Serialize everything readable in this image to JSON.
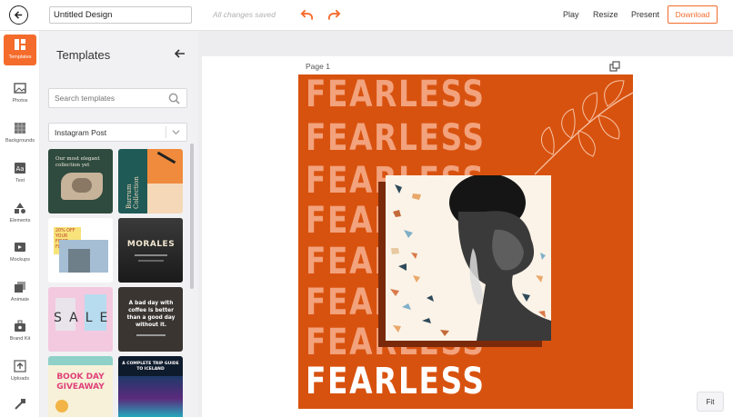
{
  "topbar": {
    "document_title": "Untitled Design",
    "save_status": "All changes saved",
    "play_label": "Play",
    "resize_label": "Resize",
    "present_label": "Present",
    "download_label": "Download",
    "accent_color": "#f46b2c"
  },
  "rail": {
    "items": [
      {
        "label": "Templates",
        "icon": "templates-icon"
      },
      {
        "label": "Photos",
        "icon": "photos-icon"
      },
      {
        "label": "Backgrounds",
        "icon": "backgrounds-icon"
      },
      {
        "label": "Text",
        "icon": "text-icon"
      },
      {
        "label": "Elements",
        "icon": "elements-icon"
      },
      {
        "label": "Mockups",
        "icon": "mockups-icon"
      },
      {
        "label": "Animate",
        "icon": "animate-icon"
      },
      {
        "label": "Brand Kit",
        "icon": "brand-kit-icon"
      },
      {
        "label": "Uploads",
        "icon": "uploads-icon"
      }
    ]
  },
  "panel": {
    "title": "Templates",
    "search_placeholder": "Search templates",
    "format_selected": "Instagram Post",
    "thumbnails": [
      {
        "text": "Our most elegant collection yet",
        "bg": "#2f4a3e"
      },
      {
        "text": "Burrum Collection",
        "bg": "#f4d8b8"
      },
      {
        "text": "20% OFF YOUR FIRST FLIGHT",
        "bg": "#f7e37a"
      },
      {
        "text": "MORALES",
        "bg": "#2a2a2a"
      },
      {
        "text": "SALE",
        "bg": "#f3c9df"
      },
      {
        "text": "A bad day with coffee is better than a good day without it.",
        "bg": "#3a3531"
      },
      {
        "text": "BOOK DAY GIVEAWAY",
        "bg": "#f6f1d8"
      },
      {
        "text": "A COMPLETE TRIP GUIDE TO ICELAND",
        "bg": "#0e1b2c"
      }
    ]
  },
  "canvas": {
    "page_label": "Page 1",
    "headline_word": "FEARLESS",
    "design_bg": "#d8520f",
    "fit_label": "Fit"
  }
}
